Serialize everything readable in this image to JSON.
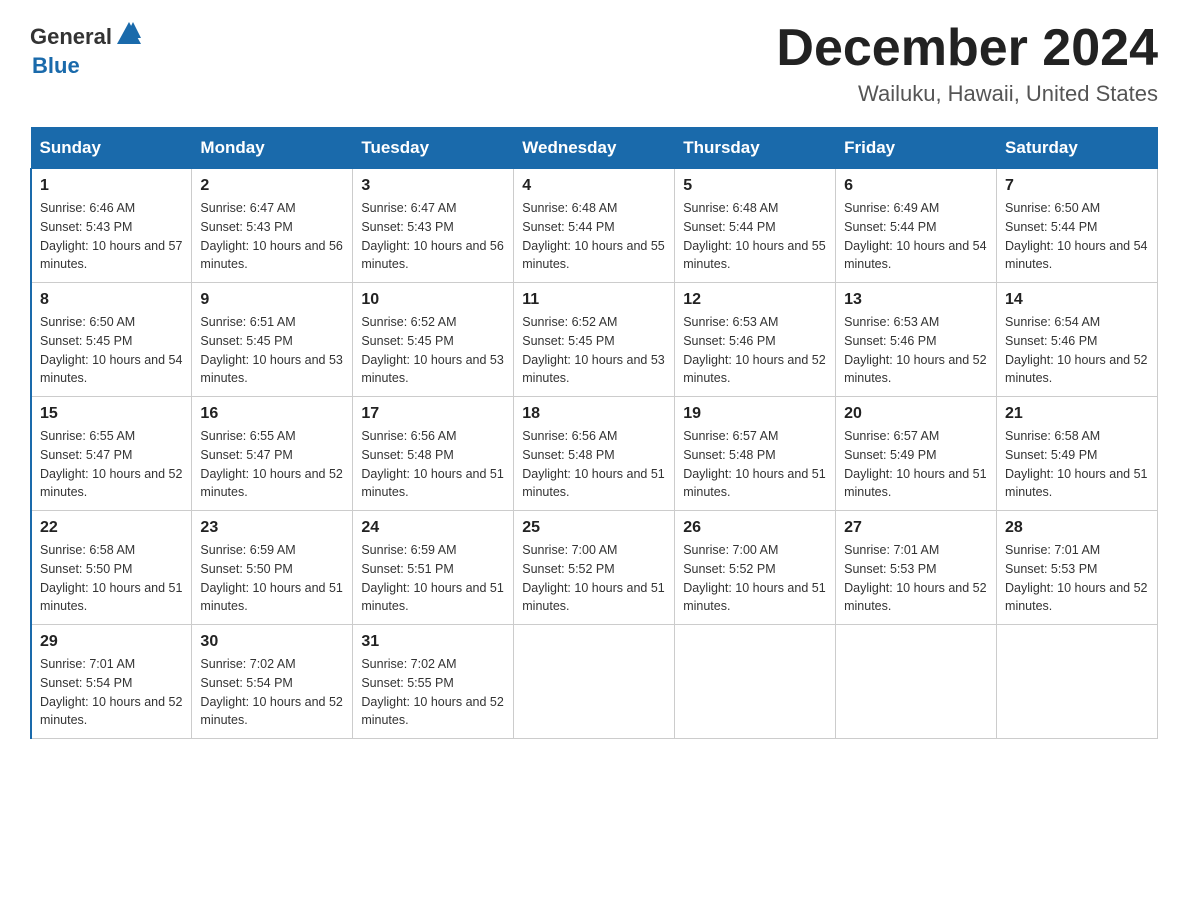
{
  "header": {
    "logo_general": "General",
    "logo_blue": "Blue",
    "month_title": "December 2024",
    "location": "Wailuku, Hawaii, United States"
  },
  "days_of_week": [
    "Sunday",
    "Monday",
    "Tuesday",
    "Wednesday",
    "Thursday",
    "Friday",
    "Saturday"
  ],
  "weeks": [
    [
      {
        "day": "1",
        "sunrise": "Sunrise: 6:46 AM",
        "sunset": "Sunset: 5:43 PM",
        "daylight": "Daylight: 10 hours and 57 minutes."
      },
      {
        "day": "2",
        "sunrise": "Sunrise: 6:47 AM",
        "sunset": "Sunset: 5:43 PM",
        "daylight": "Daylight: 10 hours and 56 minutes."
      },
      {
        "day": "3",
        "sunrise": "Sunrise: 6:47 AM",
        "sunset": "Sunset: 5:43 PM",
        "daylight": "Daylight: 10 hours and 56 minutes."
      },
      {
        "day": "4",
        "sunrise": "Sunrise: 6:48 AM",
        "sunset": "Sunset: 5:44 PM",
        "daylight": "Daylight: 10 hours and 55 minutes."
      },
      {
        "day": "5",
        "sunrise": "Sunrise: 6:48 AM",
        "sunset": "Sunset: 5:44 PM",
        "daylight": "Daylight: 10 hours and 55 minutes."
      },
      {
        "day": "6",
        "sunrise": "Sunrise: 6:49 AM",
        "sunset": "Sunset: 5:44 PM",
        "daylight": "Daylight: 10 hours and 54 minutes."
      },
      {
        "day": "7",
        "sunrise": "Sunrise: 6:50 AM",
        "sunset": "Sunset: 5:44 PM",
        "daylight": "Daylight: 10 hours and 54 minutes."
      }
    ],
    [
      {
        "day": "8",
        "sunrise": "Sunrise: 6:50 AM",
        "sunset": "Sunset: 5:45 PM",
        "daylight": "Daylight: 10 hours and 54 minutes."
      },
      {
        "day": "9",
        "sunrise": "Sunrise: 6:51 AM",
        "sunset": "Sunset: 5:45 PM",
        "daylight": "Daylight: 10 hours and 53 minutes."
      },
      {
        "day": "10",
        "sunrise": "Sunrise: 6:52 AM",
        "sunset": "Sunset: 5:45 PM",
        "daylight": "Daylight: 10 hours and 53 minutes."
      },
      {
        "day": "11",
        "sunrise": "Sunrise: 6:52 AM",
        "sunset": "Sunset: 5:45 PM",
        "daylight": "Daylight: 10 hours and 53 minutes."
      },
      {
        "day": "12",
        "sunrise": "Sunrise: 6:53 AM",
        "sunset": "Sunset: 5:46 PM",
        "daylight": "Daylight: 10 hours and 52 minutes."
      },
      {
        "day": "13",
        "sunrise": "Sunrise: 6:53 AM",
        "sunset": "Sunset: 5:46 PM",
        "daylight": "Daylight: 10 hours and 52 minutes."
      },
      {
        "day": "14",
        "sunrise": "Sunrise: 6:54 AM",
        "sunset": "Sunset: 5:46 PM",
        "daylight": "Daylight: 10 hours and 52 minutes."
      }
    ],
    [
      {
        "day": "15",
        "sunrise": "Sunrise: 6:55 AM",
        "sunset": "Sunset: 5:47 PM",
        "daylight": "Daylight: 10 hours and 52 minutes."
      },
      {
        "day": "16",
        "sunrise": "Sunrise: 6:55 AM",
        "sunset": "Sunset: 5:47 PM",
        "daylight": "Daylight: 10 hours and 52 minutes."
      },
      {
        "day": "17",
        "sunrise": "Sunrise: 6:56 AM",
        "sunset": "Sunset: 5:48 PM",
        "daylight": "Daylight: 10 hours and 51 minutes."
      },
      {
        "day": "18",
        "sunrise": "Sunrise: 6:56 AM",
        "sunset": "Sunset: 5:48 PM",
        "daylight": "Daylight: 10 hours and 51 minutes."
      },
      {
        "day": "19",
        "sunrise": "Sunrise: 6:57 AM",
        "sunset": "Sunset: 5:48 PM",
        "daylight": "Daylight: 10 hours and 51 minutes."
      },
      {
        "day": "20",
        "sunrise": "Sunrise: 6:57 AM",
        "sunset": "Sunset: 5:49 PM",
        "daylight": "Daylight: 10 hours and 51 minutes."
      },
      {
        "day": "21",
        "sunrise": "Sunrise: 6:58 AM",
        "sunset": "Sunset: 5:49 PM",
        "daylight": "Daylight: 10 hours and 51 minutes."
      }
    ],
    [
      {
        "day": "22",
        "sunrise": "Sunrise: 6:58 AM",
        "sunset": "Sunset: 5:50 PM",
        "daylight": "Daylight: 10 hours and 51 minutes."
      },
      {
        "day": "23",
        "sunrise": "Sunrise: 6:59 AM",
        "sunset": "Sunset: 5:50 PM",
        "daylight": "Daylight: 10 hours and 51 minutes."
      },
      {
        "day": "24",
        "sunrise": "Sunrise: 6:59 AM",
        "sunset": "Sunset: 5:51 PM",
        "daylight": "Daylight: 10 hours and 51 minutes."
      },
      {
        "day": "25",
        "sunrise": "Sunrise: 7:00 AM",
        "sunset": "Sunset: 5:52 PM",
        "daylight": "Daylight: 10 hours and 51 minutes."
      },
      {
        "day": "26",
        "sunrise": "Sunrise: 7:00 AM",
        "sunset": "Sunset: 5:52 PM",
        "daylight": "Daylight: 10 hours and 51 minutes."
      },
      {
        "day": "27",
        "sunrise": "Sunrise: 7:01 AM",
        "sunset": "Sunset: 5:53 PM",
        "daylight": "Daylight: 10 hours and 52 minutes."
      },
      {
        "day": "28",
        "sunrise": "Sunrise: 7:01 AM",
        "sunset": "Sunset: 5:53 PM",
        "daylight": "Daylight: 10 hours and 52 minutes."
      }
    ],
    [
      {
        "day": "29",
        "sunrise": "Sunrise: 7:01 AM",
        "sunset": "Sunset: 5:54 PM",
        "daylight": "Daylight: 10 hours and 52 minutes."
      },
      {
        "day": "30",
        "sunrise": "Sunrise: 7:02 AM",
        "sunset": "Sunset: 5:54 PM",
        "daylight": "Daylight: 10 hours and 52 minutes."
      },
      {
        "day": "31",
        "sunrise": "Sunrise: 7:02 AM",
        "sunset": "Sunset: 5:55 PM",
        "daylight": "Daylight: 10 hours and 52 minutes."
      },
      null,
      null,
      null,
      null
    ]
  ]
}
